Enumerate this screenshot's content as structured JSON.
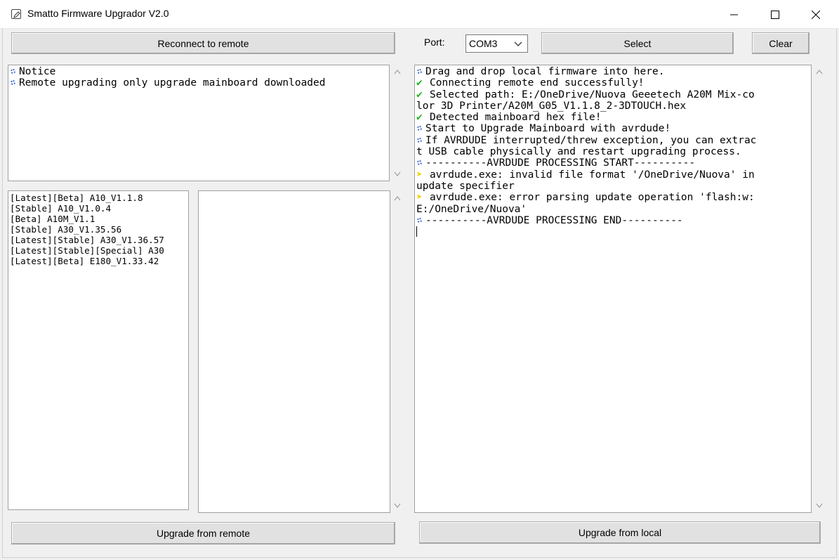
{
  "window": {
    "title": "Smatto Firmware Upgrador V2.0",
    "app_icon": "pencil-icon",
    "controls": {
      "minimize": "minimize-icon",
      "maximize": "maximize-icon",
      "close": "close-icon"
    }
  },
  "toolbar": {
    "reconnect_label": "Reconnect to remote",
    "port_label": "Port:",
    "port_value": "COM3",
    "select_label": "Select",
    "clear_label": "Clear"
  },
  "notice": {
    "lines": [
      "Notice",
      "Remote upgrading only upgrade mainboard downloaded"
    ]
  },
  "firmware_list": {
    "items": [
      "[Latest][Beta] A10_V1.1.8",
      "[Stable] A10_V1.0.4",
      "[Beta] A10M_V1.1",
      "[Stable] A30_V1.35.56",
      "[Latest][Stable] A30_V1.36.57",
      "[Latest][Stable][Special] A30",
      "[Latest][Beta] E180_V1.33.42"
    ]
  },
  "log": {
    "lines": [
      {
        "icon": "bullet-icon",
        "text": "Drag and drop local firmware into here."
      },
      {
        "icon": "check-icon",
        "text": "Connecting remote end successfully!"
      },
      {
        "icon": "check-icon",
        "text": "Selected path: E:/OneDrive/Nuova Geeetech A20M Mix-co"
      },
      {
        "icon": "",
        "text": "lor 3D Printer/A20M_G05_V1.1.8_2-3DTOUCH.hex"
      },
      {
        "icon": "check-icon",
        "text": "Detected mainboard hex file!"
      },
      {
        "icon": "bullet-icon",
        "text": "Start to Upgrade Mainboard with avrdude!"
      },
      {
        "icon": "bullet-icon",
        "text": "If AVRDUDE interrupted/threw exception, you can extrac"
      },
      {
        "icon": "",
        "text": "t USB cable physically and restart upgrading process."
      },
      {
        "icon": "bullet-icon",
        "text": "----------AVRDUDE PROCESSING START----------"
      },
      {
        "icon": "arrow-icon",
        "text": "avrdude.exe: invalid file format '/OneDrive/Nuova' in"
      },
      {
        "icon": "",
        "text": "update specifier"
      },
      {
        "icon": "arrow-icon",
        "text": "avrdude.exe: error parsing update operation 'flash:w:"
      },
      {
        "icon": "",
        "text": "E:/OneDrive/Nuova'"
      },
      {
        "icon": "bullet-icon",
        "text": "----------AVRDUDE PROCESSING END----------"
      }
    ]
  },
  "footer": {
    "upgrade_remote_label": "Upgrade from remote",
    "upgrade_local_label": "Upgrade from local"
  }
}
